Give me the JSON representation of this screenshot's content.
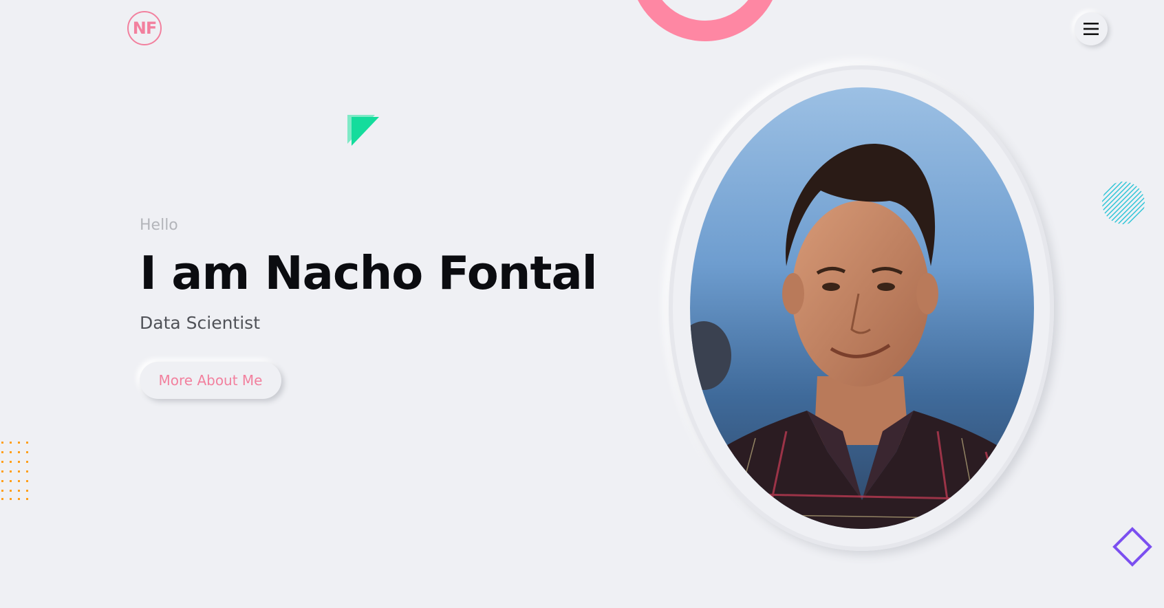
{
  "header": {
    "logo_text": "NF",
    "menu_icon": "hamburger-icon"
  },
  "hero": {
    "greeting": "Hello",
    "name": "I am Nacho Fontal",
    "role": "Data Scientist",
    "cta_label": "More About Me"
  },
  "decorations": {
    "ring_color": "#fe87a3",
    "triangle_color": "#14dc9c",
    "stripes_color": "#29c3d5",
    "dots_color": "#ff9f1a",
    "diamond_color": "#7b4ff0"
  },
  "colors": {
    "background": "#eff0f4",
    "accent": "#f2809e",
    "heading": "#0b0c10"
  }
}
